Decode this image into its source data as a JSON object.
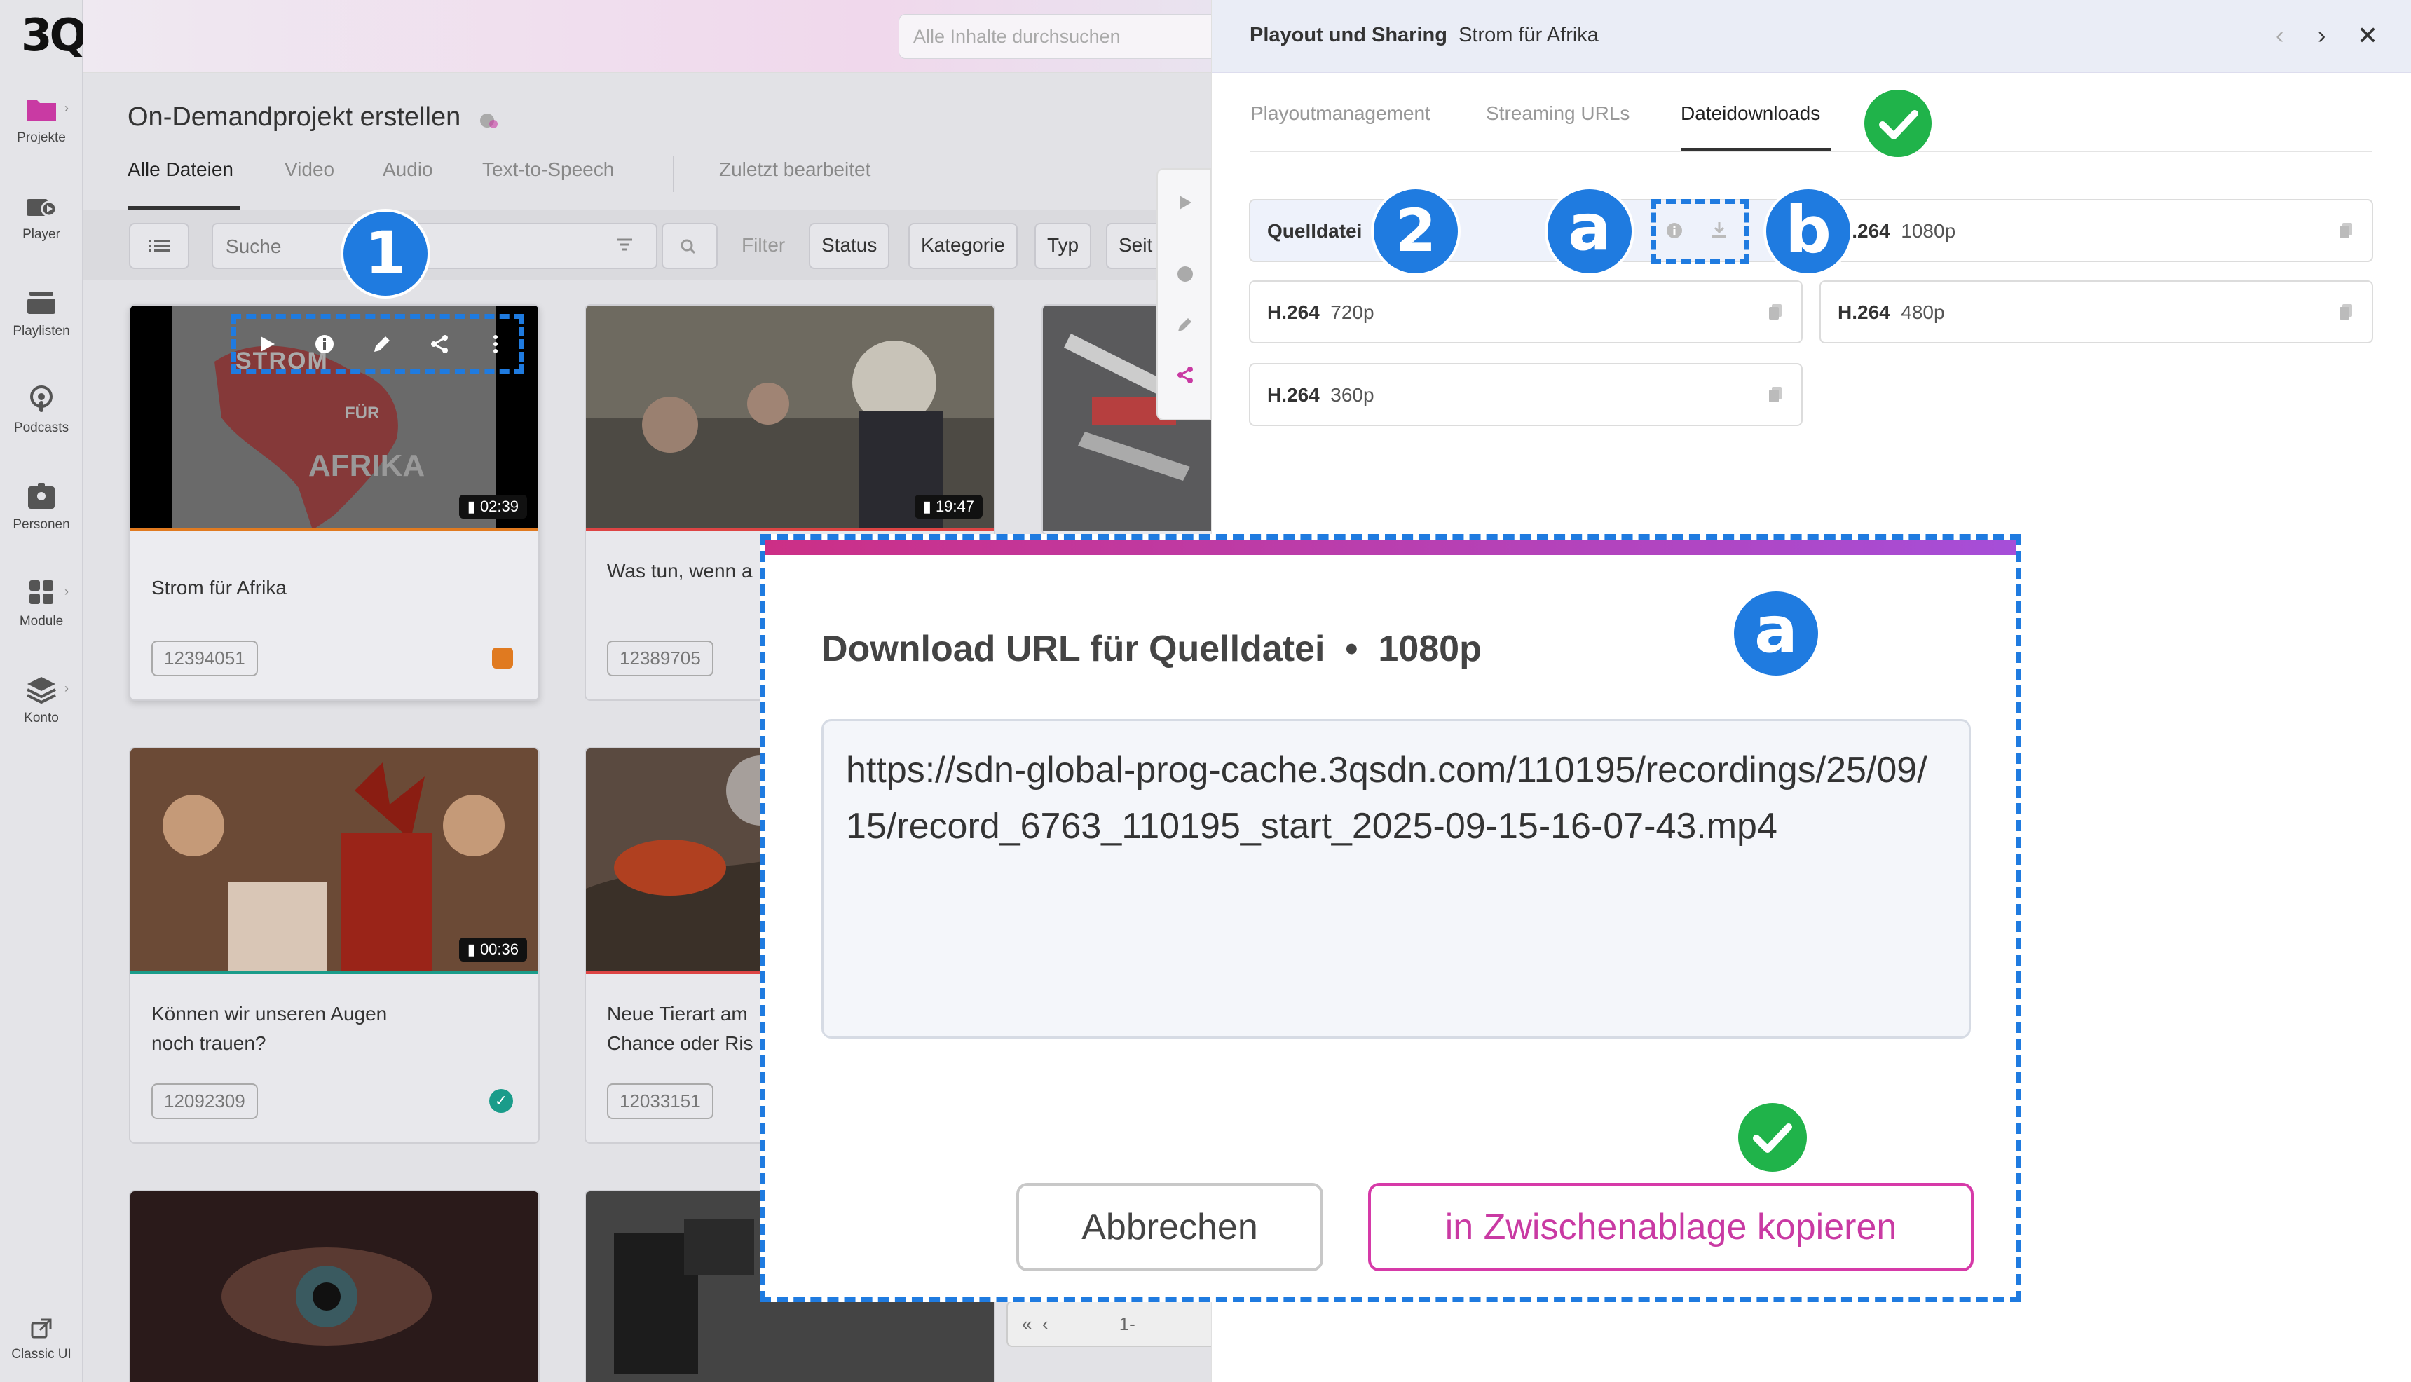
{
  "brand": {
    "logo": "3Q",
    "accent": "#c93aa3",
    "callout": "#1f7be0",
    "ok": "#20b34a"
  },
  "rail": {
    "items": [
      {
        "label": "Projekte"
      },
      {
        "label": "Player"
      },
      {
        "label": "Playlisten"
      },
      {
        "label": "Podcasts"
      },
      {
        "label": "Personen"
      },
      {
        "label": "Module"
      },
      {
        "label": "Konto"
      }
    ],
    "classic": "Classic UI"
  },
  "header": {
    "search_placeholder": "Alle Inhalte durchsuchen"
  },
  "project": {
    "title": "On-Demandprojekt erstellen",
    "tabs": [
      "Alle Dateien",
      "Video",
      "Audio",
      "Text-to-Speech",
      "Zuletzt bearbeitet"
    ],
    "search_placeholder": "Suche",
    "filter_label": "Filter",
    "filters": [
      "Status",
      "Kategorie",
      "Typ",
      "Seit"
    ]
  },
  "cards": [
    {
      "title": "Strom für Afrika",
      "duration": "02:39",
      "id": "12394051",
      "thumb_text": [
        "STROM",
        "FÜR",
        "AFRIKA"
      ]
    },
    {
      "title": "Was tun, wenn a",
      "duration": "19:47",
      "id": "12389705"
    },
    {
      "title": "Können wir unseren Augen",
      "title2": "noch trauen?",
      "duration": "00:36",
      "id": "12092309"
    },
    {
      "title": "Neue Tierart am",
      "title2": "Chance oder Ris",
      "id": "12033151"
    }
  ],
  "panel": {
    "title_bold": "Playout und Sharing",
    "title_rest": "Strom für Afrika",
    "tabs": [
      "Playoutmanagement",
      "Streaming URLs",
      "Dateidownloads"
    ],
    "downloads": [
      {
        "label": "Quelldatei",
        "res": ""
      },
      {
        "label": "H.264",
        "res": "1080p"
      },
      {
        "label": "H.264",
        "res": "720p"
      },
      {
        "label": "H.264",
        "res": "480p"
      },
      {
        "label": "H.264",
        "res": "360p"
      }
    ]
  },
  "callouts": {
    "one": "1",
    "two": "2",
    "a": "a",
    "b": "b"
  },
  "modal": {
    "title": "Download URL für Quelldatei  •  1080p",
    "url": "https://sdn-global-prog-cache.3qsdn.com/110195/recordings/25/09/15/record_6763_110195_start_2025-09-15-16-07-43.mp4",
    "cancel": "Abbrechen",
    "copy": "in Zwischenablage kopieren"
  },
  "pager": {
    "text": "1-"
  }
}
